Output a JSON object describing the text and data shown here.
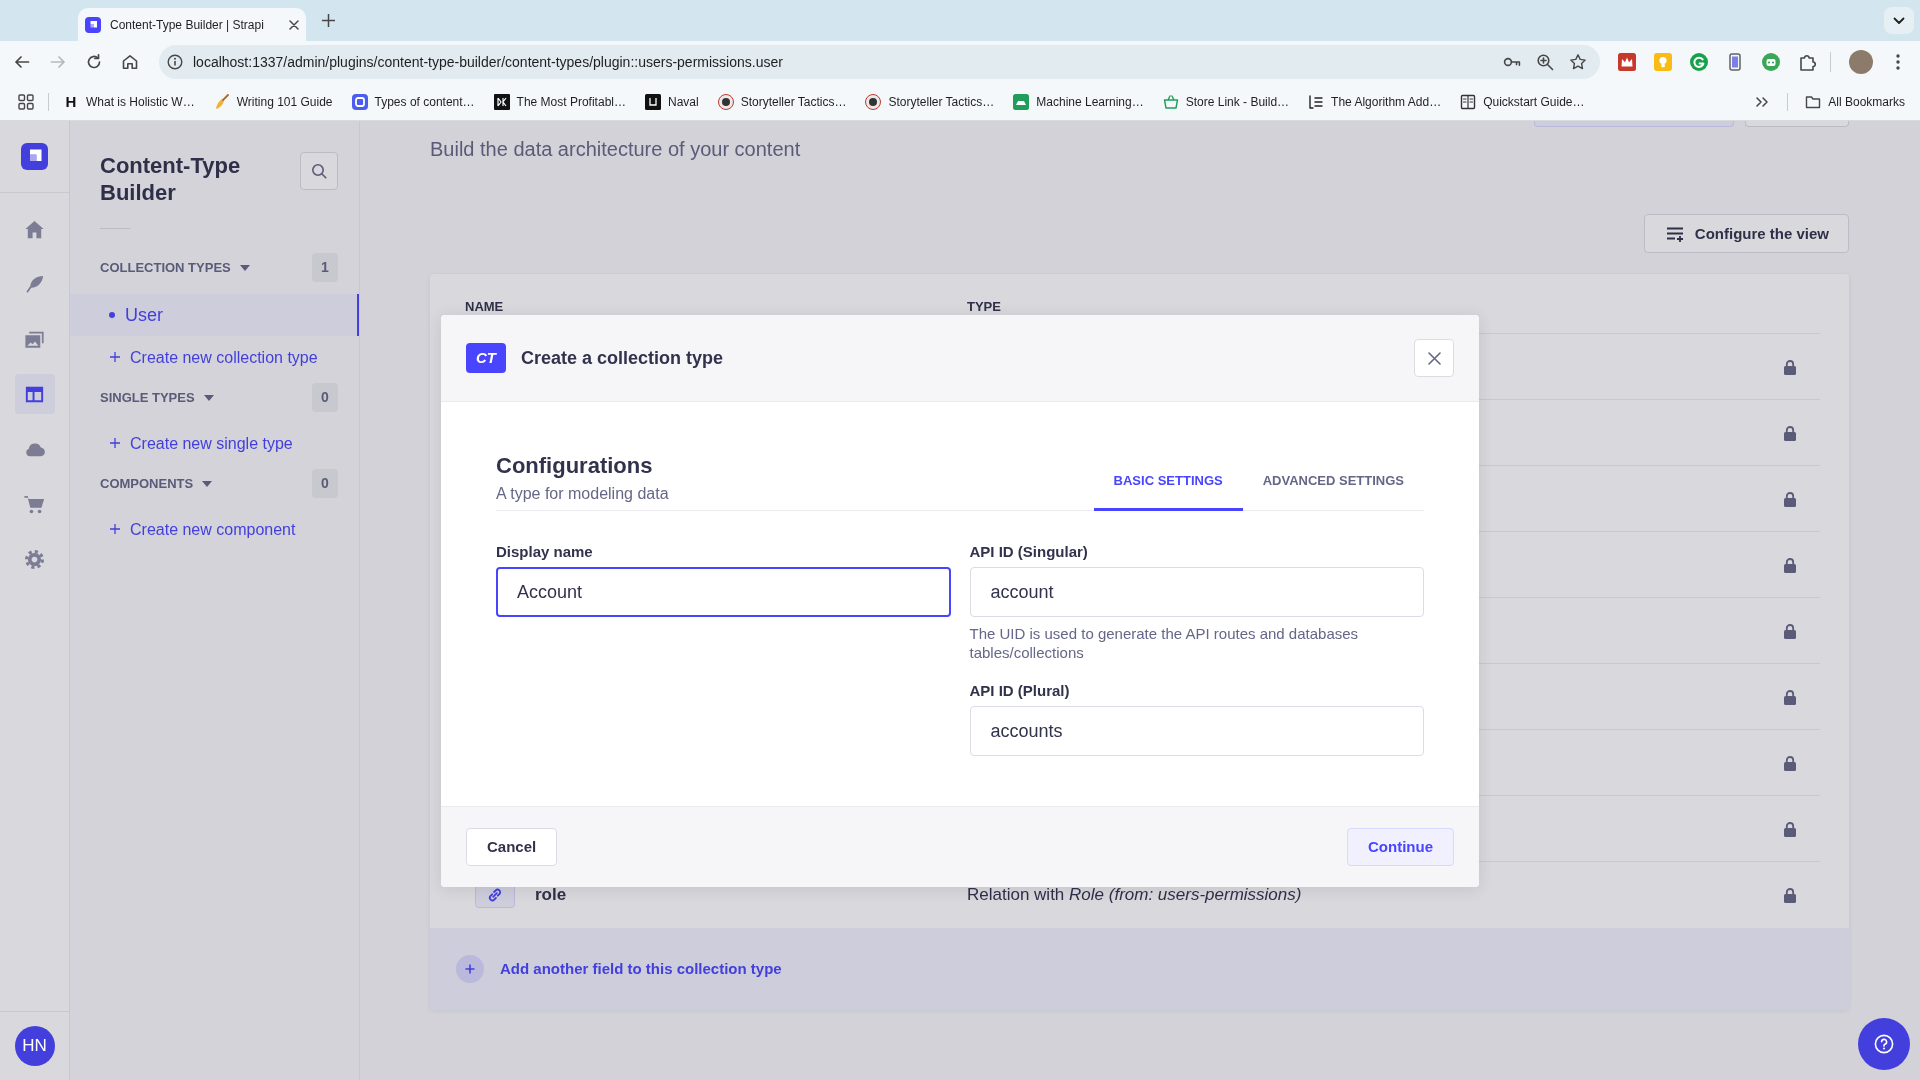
{
  "browser": {
    "tabs": [
      {
        "title": "Content-Type Builder | Strapi",
        "selected": true
      }
    ],
    "back": {
      "disabled": false
    },
    "forward": {
      "disabled": true
    },
    "address": "localhost:1337/admin/plugins/content-type-builder/content-types/plugin::users-permissions.user",
    "bookmarks": [
      {
        "favicon_letter": "H",
        "label": "What is Holistic W…"
      },
      {
        "label": "Writing 101 Guide"
      },
      {
        "label": "Types of content…"
      },
      {
        "label": "The Most Profitabl…"
      },
      {
        "label": "Naval"
      },
      {
        "label": "Storyteller Tactics…"
      },
      {
        "label": "Storyteller Tactics…"
      },
      {
        "label": "Machine Learning…"
      },
      {
        "label": "Store Link - Build…"
      },
      {
        "label": "The Algorithm Add…"
      },
      {
        "label": "Quickstart Guide…"
      }
    ],
    "all_bookmarks": "All Bookmarks"
  },
  "nav_rail": {
    "items": [
      {
        "selected": false
      },
      {
        "selected": false
      },
      {
        "selected": false
      },
      {
        "selected": true
      },
      {
        "selected": false
      },
      {
        "selected": false
      },
      {
        "selected": false
      }
    ],
    "avatar": "HN"
  },
  "sidebar": {
    "title": "Content-Type Builder",
    "sections": [
      {
        "title": "COLLECTION TYPES",
        "expanded": true,
        "count": "1",
        "items": [
          {
            "label": "User",
            "selected": true
          }
        ],
        "create_link": "Create new collection type"
      },
      {
        "title": "SINGLE TYPES",
        "expanded": true,
        "count": "0",
        "create_link": "Create new single type"
      },
      {
        "title": "COMPONENTS",
        "expanded": true,
        "count": "0",
        "create_link": "Create new component"
      }
    ]
  },
  "page": {
    "subtitle": "Build the data architecture of your content",
    "configure_button": "Configure the view",
    "table": {
      "columns": [
        "NAME",
        "TYPE"
      ],
      "rows": [
        {
          "locked": true
        },
        {
          "locked": true
        },
        {
          "locked": true
        },
        {
          "locked": true
        },
        {
          "locked": true
        },
        {
          "locked": true
        },
        {
          "locked": true
        },
        {
          "locked": true
        },
        {
          "name": "role",
          "type": "Relation with *Role (from: users-permissions)*",
          "locked": true
        }
      ]
    },
    "add_field": "Add another field to this collection type"
  },
  "modal": {
    "badge": "CT",
    "title": "Create a collection type",
    "heading": "Configurations",
    "subheading": "A type for modeling data",
    "tabs": [
      {
        "label": "BASIC SETTINGS",
        "selected": true
      },
      {
        "label": "ADVANCED SETTINGS",
        "selected": false
      }
    ],
    "fields": [
      {
        "label": "Display name",
        "value": "Account",
        "focused": true
      },
      {
        "label": "API ID (Singular)",
        "value": "account",
        "hint": "The UID is used to generate the API routes and databases tables/collections",
        "focused": false
      },
      {
        "label": "API ID (Plural)",
        "value": "accounts",
        "focused": false
      }
    ],
    "cancel": "Cancel",
    "submit": "Continue"
  }
}
